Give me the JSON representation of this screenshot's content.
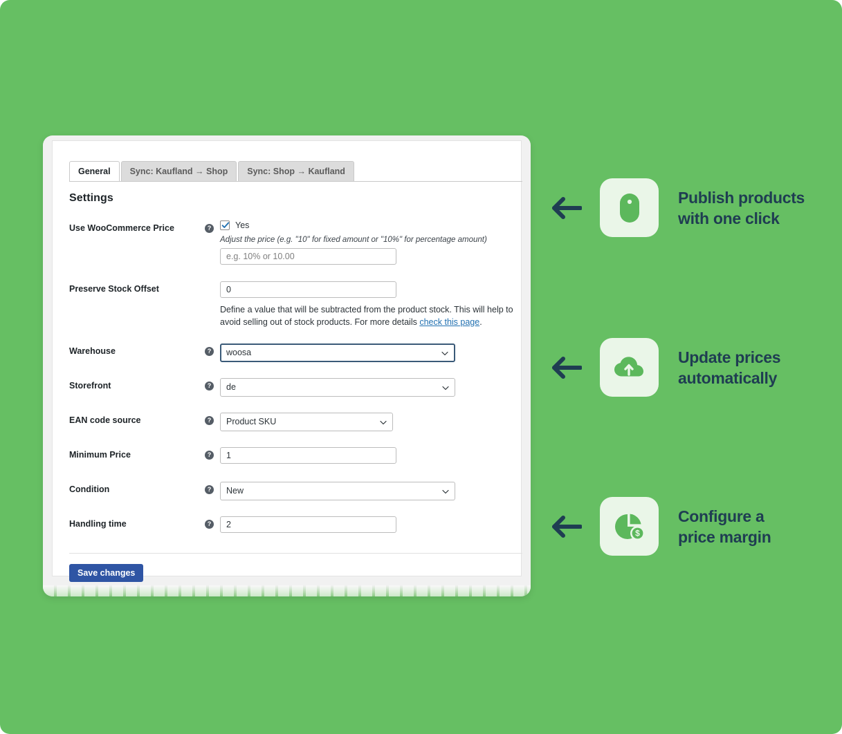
{
  "theme": {
    "background_green": "#66bf63",
    "icon_tile_bg": "#eaf6e8",
    "icon_green": "#5cb85c",
    "heading_navy": "#1f3d52",
    "primary_button": "#2f55a4",
    "link_blue": "#2271b1"
  },
  "screenshot": {
    "tabs": [
      {
        "label": "General",
        "active": true
      },
      {
        "label": "Sync: Kaufland → Shop",
        "active": false
      },
      {
        "label": "Sync: Shop → Kaufland",
        "active": false
      }
    ],
    "heading": "Settings",
    "rows": [
      {
        "label": "Use WooCommerce Price",
        "help_icon": "question-mark-icon",
        "checkbox_label": "Yes",
        "checkbox_checked": true,
        "description_italic": "Adjust the price (e.g. \"10\" for fixed amount or \"10%\" for percentage amount)",
        "input_placeholder": "e.g. 10% or 10.00",
        "input_value": ""
      },
      {
        "label": "Preserve Stock Offset",
        "input_value": "0",
        "description_part1": "Define a value that will be subtracted from the product stock. This will help to avoid selling out of stock products. For more details ",
        "description_link": "check this page",
        "description_part2": "."
      },
      {
        "label": "Warehouse",
        "help_icon": "question-mark-icon",
        "select_value": "woosa",
        "focused": true
      },
      {
        "label": "Storefront",
        "help_icon": "question-mark-icon",
        "select_value": "de",
        "focused": false
      },
      {
        "label": "EAN code source",
        "help_icon": "question-mark-icon",
        "select_value": "Product SKU",
        "focused": false
      },
      {
        "label": "Minimum Price",
        "help_icon": "question-mark-icon",
        "input_value": "1"
      },
      {
        "label": "Condition",
        "help_icon": "question-mark-icon",
        "select_value": "New",
        "focused": false
      },
      {
        "label": "Handling time",
        "help_icon": "question-mark-icon",
        "input_value": "2"
      }
    ],
    "save_label": "Save changes"
  },
  "features": [
    {
      "arrow_icon": "arrow-left-icon",
      "icon": "computer-mouse-icon",
      "text": "Publish products\nwith one click"
    },
    {
      "arrow_icon": "arrow-left-icon",
      "icon": "cloud-upload-icon",
      "text": "Update prices\nautomatically"
    },
    {
      "arrow_icon": "arrow-left-icon",
      "icon": "pie-chart-dollar-icon",
      "text": "Configure a\nprice margin"
    }
  ]
}
